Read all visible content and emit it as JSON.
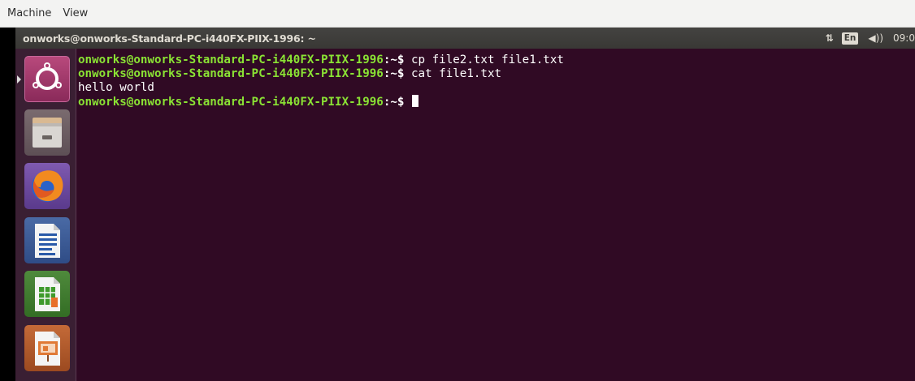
{
  "vm_menubar": {
    "items": [
      "Machine",
      "View"
    ]
  },
  "top_panel": {
    "window_title": "onworks@onworks-Standard-PC-i440FX-PIIX-1996: ~",
    "tray": {
      "network_glyph": "⇅",
      "keyboard_layout": "En",
      "volume_glyph": "◀))",
      "clock": "09:0"
    }
  },
  "launcher": {
    "items": [
      {
        "name": "ubuntu-dash-icon",
        "active": true
      },
      {
        "name": "files-icon",
        "active": false
      },
      {
        "name": "firefox-icon",
        "active": false
      },
      {
        "name": "libreoffice-writer-icon",
        "active": false
      },
      {
        "name": "libreoffice-calc-icon",
        "active": false
      },
      {
        "name": "libreoffice-impress-icon",
        "active": false
      }
    ]
  },
  "terminal": {
    "lines": [
      {
        "prompt": "onworks@onworks-Standard-PC-i440FX-PIIX-1996",
        "path": ":~$ ",
        "command": "cp file2.txt file1.txt"
      },
      {
        "prompt": "onworks@onworks-Standard-PC-i440FX-PIIX-1996",
        "path": ":~$ ",
        "command": "cat file1.txt"
      },
      {
        "output": "hello world"
      },
      {
        "prompt": "onworks@onworks-Standard-PC-i440FX-PIIX-1996",
        "path": ":~$ ",
        "command": ""
      }
    ]
  },
  "colors": {
    "terminal_bg": "#300a24",
    "prompt_green": "#8ae234",
    "launcher_bg": "#3a1f33",
    "panel_bg": "#3c3b37"
  }
}
